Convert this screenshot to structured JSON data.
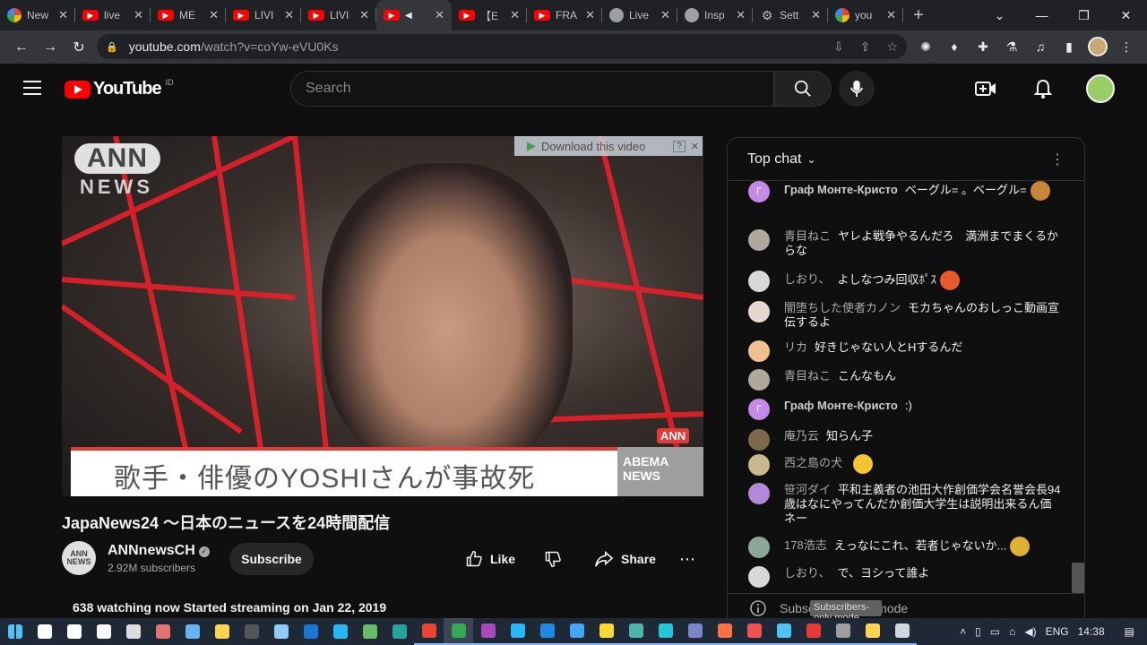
{
  "browser": {
    "tabs": [
      {
        "title": "New",
        "favicon": "chrome-icon",
        "active": false
      },
      {
        "title": "live",
        "favicon": "youtube-icon",
        "active": false
      },
      {
        "title": "ME",
        "favicon": "youtube-icon",
        "active": false
      },
      {
        "title": "LIVI",
        "favicon": "youtube-icon",
        "active": false
      },
      {
        "title": "LIVI",
        "favicon": "youtube-icon",
        "active": false
      },
      {
        "title": "",
        "favicon": "youtube-icon",
        "active": true,
        "audio": "speaker-icon"
      },
      {
        "title": "【E",
        "favicon": "youtube-icon",
        "active": false
      },
      {
        "title": "FRA",
        "favicon": "youtube-icon",
        "active": false
      },
      {
        "title": "Live",
        "favicon": "globe-icon",
        "active": false
      },
      {
        "title": "Insp",
        "favicon": "globe-icon",
        "active": false
      },
      {
        "title": "Sett",
        "favicon": "gear-icon",
        "active": false
      },
      {
        "title": "you",
        "favicon": "google-icon",
        "active": false
      }
    ],
    "new_tab_label": "+",
    "url_domain": "youtube.com",
    "url_path": "/watch?v=coYw-eVU0Ks"
  },
  "youtube": {
    "logo_text": "YouTube",
    "country_code": "ID",
    "search_placeholder": "Search"
  },
  "video": {
    "overlay_logo": "ANN",
    "overlay_logo_sub": "NEWS",
    "download_prompt": "Download this video",
    "download_help": "?",
    "caption": "歌手・俳優のYOSHIさんが事故死",
    "corner_badge": "ANN",
    "brand_text": "ABEMA NEWS",
    "title": "JapaNews24 ～日本のニュースを24時間配信"
  },
  "channel": {
    "avatar_line1": "ANN",
    "avatar_line2": "NEWS",
    "name": "ANNnewsCH",
    "subscribers": "2.92M subscribers",
    "subscribe_label": "Subscribe"
  },
  "actions": {
    "like_label": "Like",
    "share_label": "Share"
  },
  "description": {
    "meta": "638 watching now  Started streaming on Jan 22, 2019"
  },
  "chat": {
    "header": "Top chat",
    "messages": [
      {
        "author": "Граф Монте-Кристо",
        "text": "ベーグル= 。ベーグル=",
        "avatar_letter": "Г",
        "avatar_color": "#c589e8",
        "bold": true
      },
      {
        "author": "青目ねこ",
        "text": "ヤレよ戦争やるんだろ　満洲までまくるからな",
        "avatar_letter": "",
        "avatar_color": "#b0a89a",
        "bold": false
      },
      {
        "author": "しおり、",
        "text": "よしなつみ回収ﾎﾟｽ",
        "avatar_letter": "",
        "avatar_color": "#d8d8d8",
        "bold": false
      },
      {
        "author": "闇堕ちした使者カノン",
        "text": "モカちゃんのおしっこ動画宣伝するよ",
        "avatar_letter": "",
        "avatar_color": "#e6d8d0",
        "bold": false
      },
      {
        "author": "リカ",
        "text": "好きじゃない人とHするんだ",
        "avatar_letter": "",
        "avatar_color": "#f0c090",
        "bold": false
      },
      {
        "author": "青目ねこ",
        "text": "こんなもん",
        "avatar_letter": "",
        "avatar_color": "#b0a89a",
        "bold": false
      },
      {
        "author": "Граф Монте-Кристо",
        "text": ":)",
        "avatar_letter": "Г",
        "avatar_color": "#c589e8",
        "bold": true
      },
      {
        "author": "庵乃云",
        "text": "知らん子",
        "avatar_letter": "",
        "avatar_color": "#7a6a4a",
        "bold": false
      },
      {
        "author": "西之島の犬",
        "text": "",
        "avatar_letter": "",
        "avatar_color": "#c8b890",
        "bold": false
      },
      {
        "author": "笹河ダイ",
        "text": "平和主義者の池田大作創価学会名誉会長94歳はなにやってんだか創価大学生は説明出来るん価ネー",
        "avatar_letter": "",
        "avatar_color": "#b388d8",
        "bold": false
      },
      {
        "author": "178浩志",
        "text": "えっなにこれ、若者じゃないか...",
        "avatar_letter": "",
        "avatar_color": "#8aa898",
        "bold": false
      },
      {
        "author": "しおり、",
        "text": "で、ヨシって誰よ",
        "avatar_letter": "",
        "avatar_color": "#d8d8d8",
        "bold": false
      }
    ],
    "footer": "Subscribers-only mode",
    "tooltip": "Subscribers-only mode"
  },
  "taskbar": {
    "language": "ENG",
    "time": "14:38"
  }
}
